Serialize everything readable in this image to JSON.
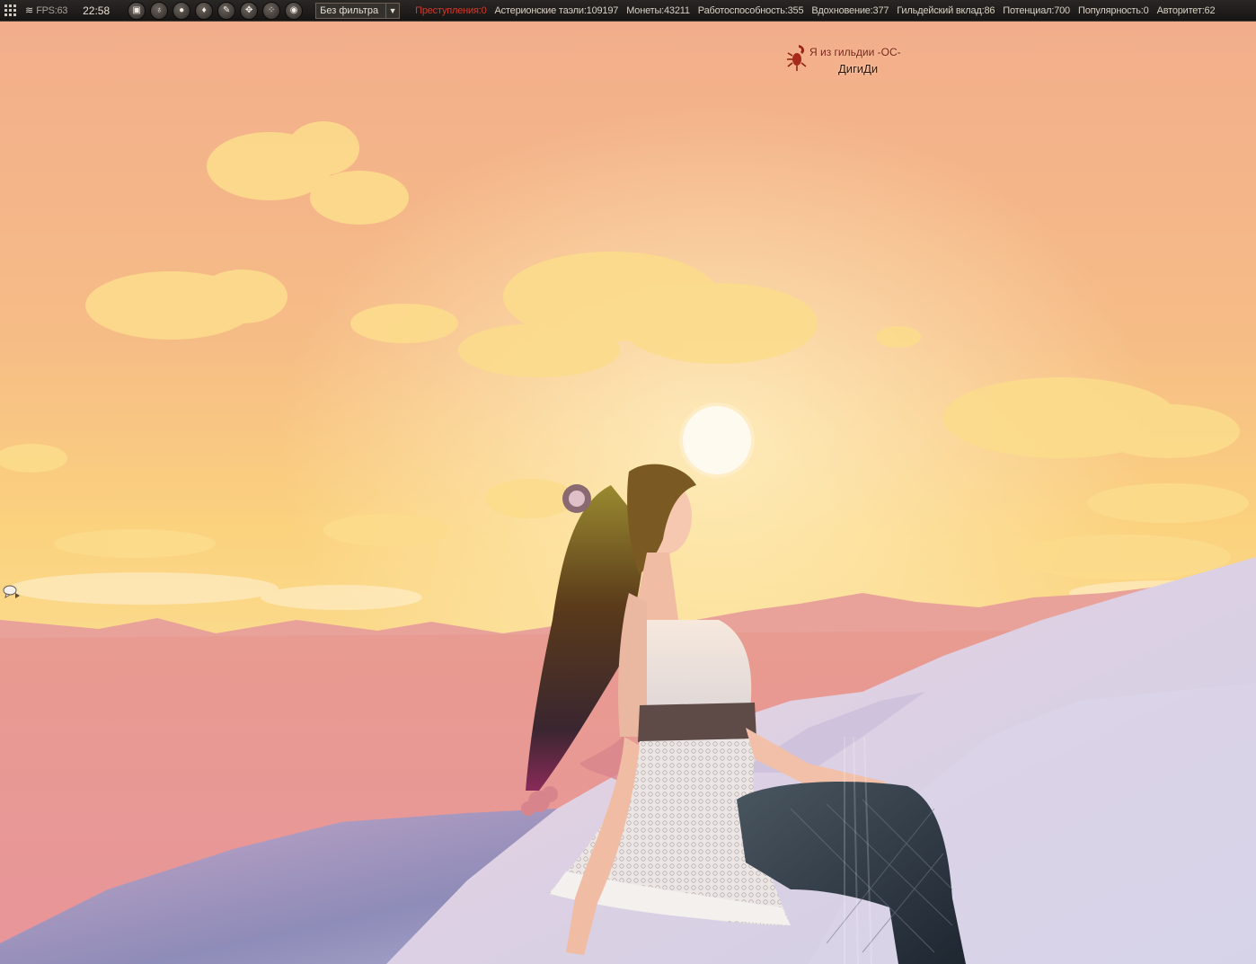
{
  "hud": {
    "fps_label": "FPS:63",
    "time": "22:58",
    "wifi_icon": "wifi-signal-icon",
    "tools": [
      {
        "name": "camera-icon",
        "glyph": "▣"
      },
      {
        "name": "bag-icon",
        "glyph": "♁"
      },
      {
        "name": "chat-bubble-icon",
        "glyph": "●"
      },
      {
        "name": "costume-icon",
        "glyph": "♦"
      },
      {
        "name": "sword-icon",
        "glyph": "✎"
      },
      {
        "name": "move-arrows-icon",
        "glyph": "✥"
      },
      {
        "name": "party-icon",
        "glyph": "⁘"
      },
      {
        "name": "eye-icon",
        "glyph": "◉"
      }
    ],
    "filter_value": "Без фильтра",
    "stats": {
      "crime": "Преступления:0",
      "tael": "Астерионские таэли:109197",
      "coins": "Монеты:43211",
      "efficiency": "Работоспособность:355",
      "inspiration": "Вдохновение:377",
      "guild_contribution": "Гильдейский вклад:86",
      "potential": "Потенциал:700",
      "popularity": "Популярность:0",
      "authority": "Авторитет:62"
    },
    "colors": {
      "bar": "#1d1a19",
      "text": "#d8d0c4",
      "crime": "#d03a2c"
    }
  },
  "nameplate": {
    "guild_text": "Я из гильдии -ОС-",
    "player_name": "ДигиДи",
    "emblem_icon": "scorpion-emblem-icon",
    "guild_color": "#7a1e14"
  },
  "chat": {
    "toggle_icon": "chat-toggle-icon"
  }
}
